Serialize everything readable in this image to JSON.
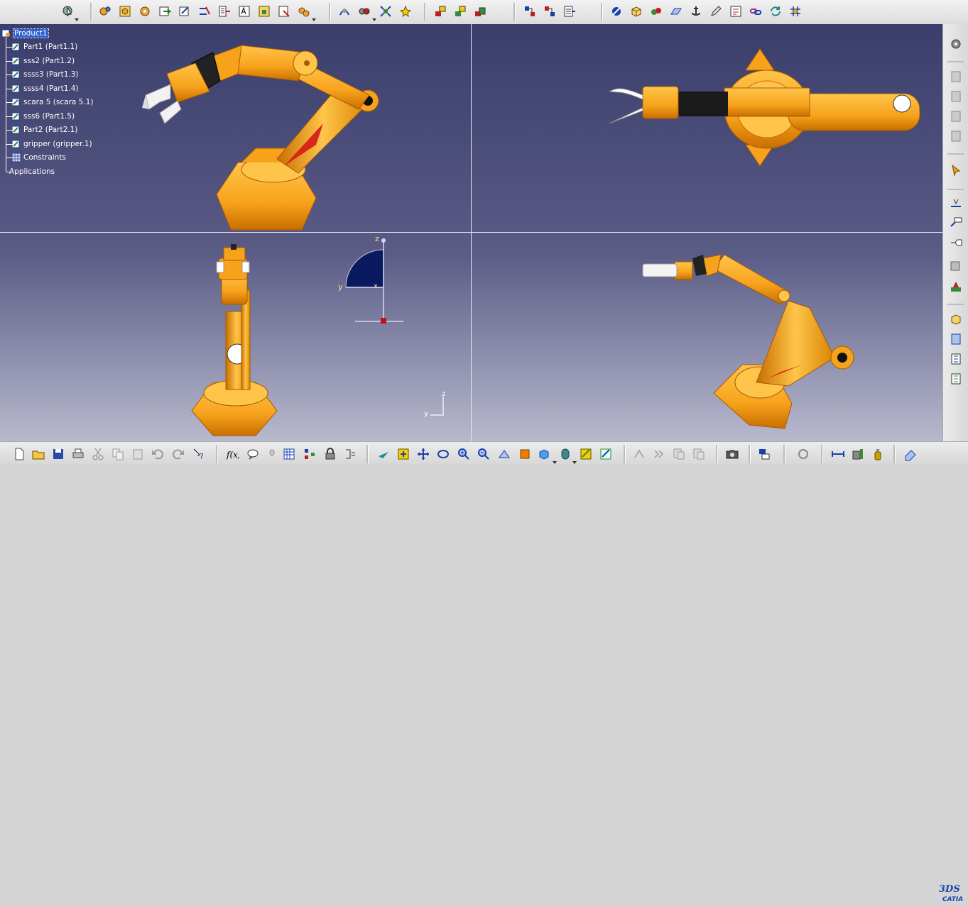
{
  "product_tree": {
    "root": "Product1",
    "items": [
      {
        "label": "Part1 (Part1.1)",
        "icon": "part-icon"
      },
      {
        "label": "sss2 (Part1.2)",
        "icon": "part-icon"
      },
      {
        "label": "ssss3 (Part1.3)",
        "icon": "part-icon"
      },
      {
        "label": "ssss4 (Part1.4)",
        "icon": "part-icon"
      },
      {
        "label": "scara 5 (scara 5.1)",
        "icon": "part-icon"
      },
      {
        "label": "sss6 (Part1.5)",
        "icon": "part-icon"
      },
      {
        "label": "Part2 (Part2.1)",
        "icon": "part-icon"
      },
      {
        "label": "gripper (gripper.1)",
        "icon": "part-icon"
      },
      {
        "label": "Constraints",
        "icon": "constraints-icon"
      }
    ],
    "applications": "Applications"
  },
  "compass": {
    "z": "z",
    "y": "y",
    "x": "x"
  },
  "axis_triad": {
    "z": "z",
    "y": "y"
  },
  "logo": {
    "text": "CATIA",
    "mark": "3DS"
  },
  "colors": {
    "robot_orange": "#f7a21b",
    "robot_shadow": "#c86e00",
    "accent_red": "#d9261c",
    "viewport_top": "#3b3d6b",
    "viewport_bottom": "#b8b9cd",
    "selection": "#2f5fd0"
  }
}
